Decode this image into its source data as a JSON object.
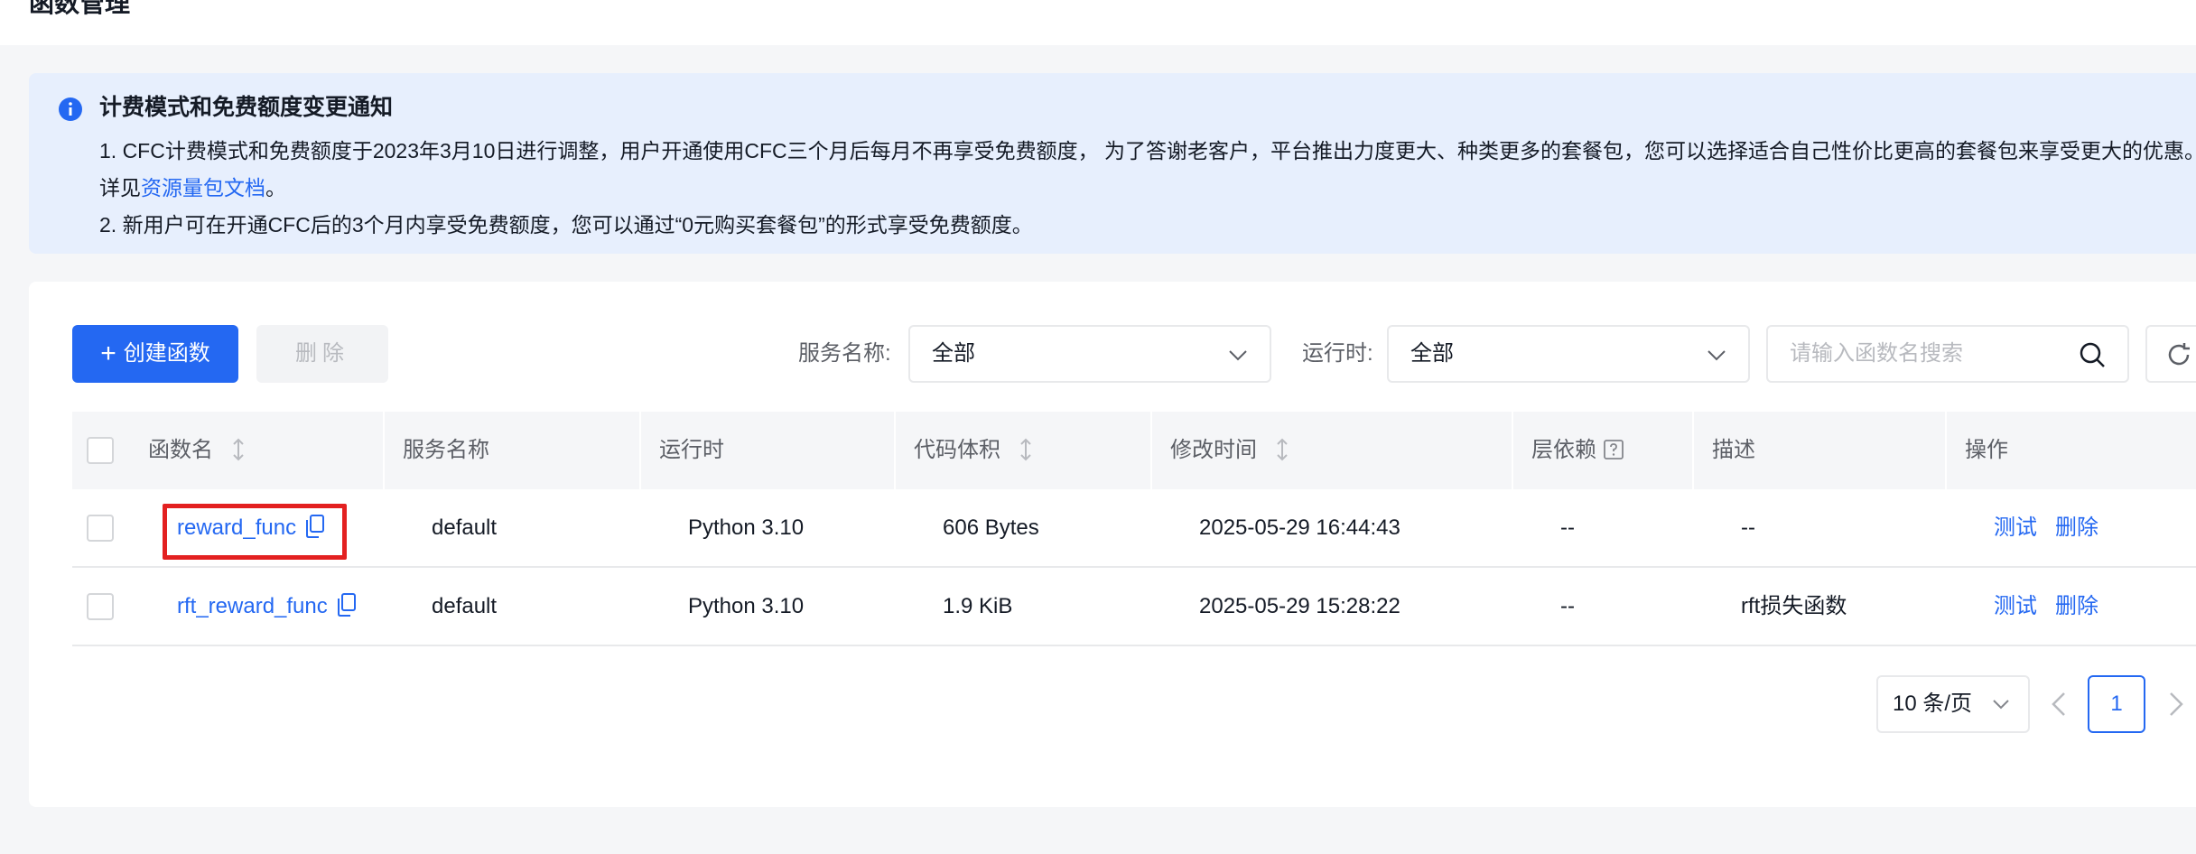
{
  "page": {
    "title": "函数管理"
  },
  "notice": {
    "title": "计费模式和免费额度变更通知",
    "line1_text": "1. CFC计费模式和免费额度于2023年3月10日进行调整，用户开通使用CFC三个月后每月不再享受免费额度， 为了答谢老客户，平台推出力度更大、种类更多的套餐包，您可以选择适合自己性价比更高的套餐包来享受更大的优惠。 详见",
    "line1_link": "资源量包文档",
    "line1_end": "。",
    "line2": "2. 新用户可在开通CFC后的3个月内享受免费额度，您可以通过“0元购买套餐包”的形式享受免费额度。"
  },
  "toolbar": {
    "create_label": "创建函数",
    "delete_label": "删除",
    "service_label": "服务名称:",
    "service_value": "全部",
    "runtime_label": "运行时:",
    "runtime_value": "全部",
    "search_placeholder": "请输入函数名搜索"
  },
  "table": {
    "columns": [
      "函数名",
      "服务名称",
      "运行时",
      "代码体积",
      "修改时间",
      "层依赖",
      "描述",
      "操作"
    ],
    "rows": [
      {
        "name": "reward_func",
        "service": "default",
        "runtime": "Python 3.10",
        "size": "606 Bytes",
        "modified": "2025-05-29 16:44:43",
        "layers": "--",
        "desc": "--"
      },
      {
        "name": "rft_reward_func",
        "service": "default",
        "runtime": "Python 3.10",
        "size": "1.9 KiB",
        "modified": "2025-05-29 15:28:22",
        "layers": "--",
        "desc": "rft损失函数"
      }
    ],
    "actions": {
      "test": "测试",
      "delete": "删除"
    }
  },
  "pagination": {
    "page_size": "10 条/页",
    "current_page": "1"
  },
  "colors": {
    "primary": "#2468f2",
    "highlight": "#e32020",
    "notice_bg": "#e7effd"
  },
  "icons": {
    "notice": "info-icon",
    "copy": "copy-icon",
    "search": "search-icon",
    "refresh": "refresh-icon",
    "sort": "sort-icon"
  }
}
